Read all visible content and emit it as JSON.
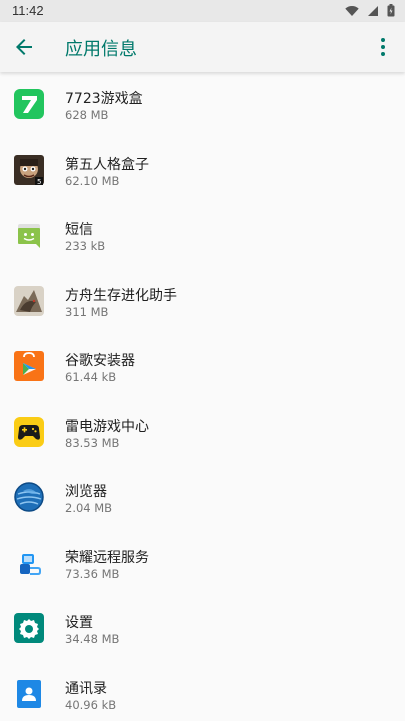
{
  "status_bar": {
    "time": "11:42"
  },
  "app_bar": {
    "title": "应用信息"
  },
  "apps": [
    {
      "name": "7723游戏盒",
      "size": "628 MB",
      "icon": "7723-game-box-icon",
      "color": "#22c55e"
    },
    {
      "name": "第五人格盒子",
      "size": "62.10 MB",
      "icon": "identity-v-box-icon",
      "color": "#4a3a2a"
    },
    {
      "name": "短信",
      "size": "233 kB",
      "icon": "messaging-icon",
      "color": "#8bc34a"
    },
    {
      "name": "方舟生存进化助手",
      "size": "311 MB",
      "icon": "ark-survival-helper-icon",
      "color": "#6b5a4a"
    },
    {
      "name": "谷歌安装器",
      "size": "61.44 kB",
      "icon": "google-installer-icon",
      "color": "#f97316"
    },
    {
      "name": "雷电游戏中心",
      "size": "83.53 MB",
      "icon": "ldplayer-game-center-icon",
      "color": "#facc15"
    },
    {
      "name": "浏览器",
      "size": "2.04 MB",
      "icon": "browser-icon",
      "color": "#1e6fb8"
    },
    {
      "name": "荣耀远程服务",
      "size": "73.36 MB",
      "icon": "honor-remote-service-icon",
      "color": "#2196f3"
    },
    {
      "name": "设置",
      "size": "34.48 MB",
      "icon": "settings-icon",
      "color": "#00897b"
    },
    {
      "name": "通讯录",
      "size": "40.96 kB",
      "icon": "contacts-icon",
      "color": "#1e88e5"
    }
  ],
  "colors": {
    "accent": "#00796b",
    "primary_text": "#212121",
    "secondary_text": "#757575"
  }
}
